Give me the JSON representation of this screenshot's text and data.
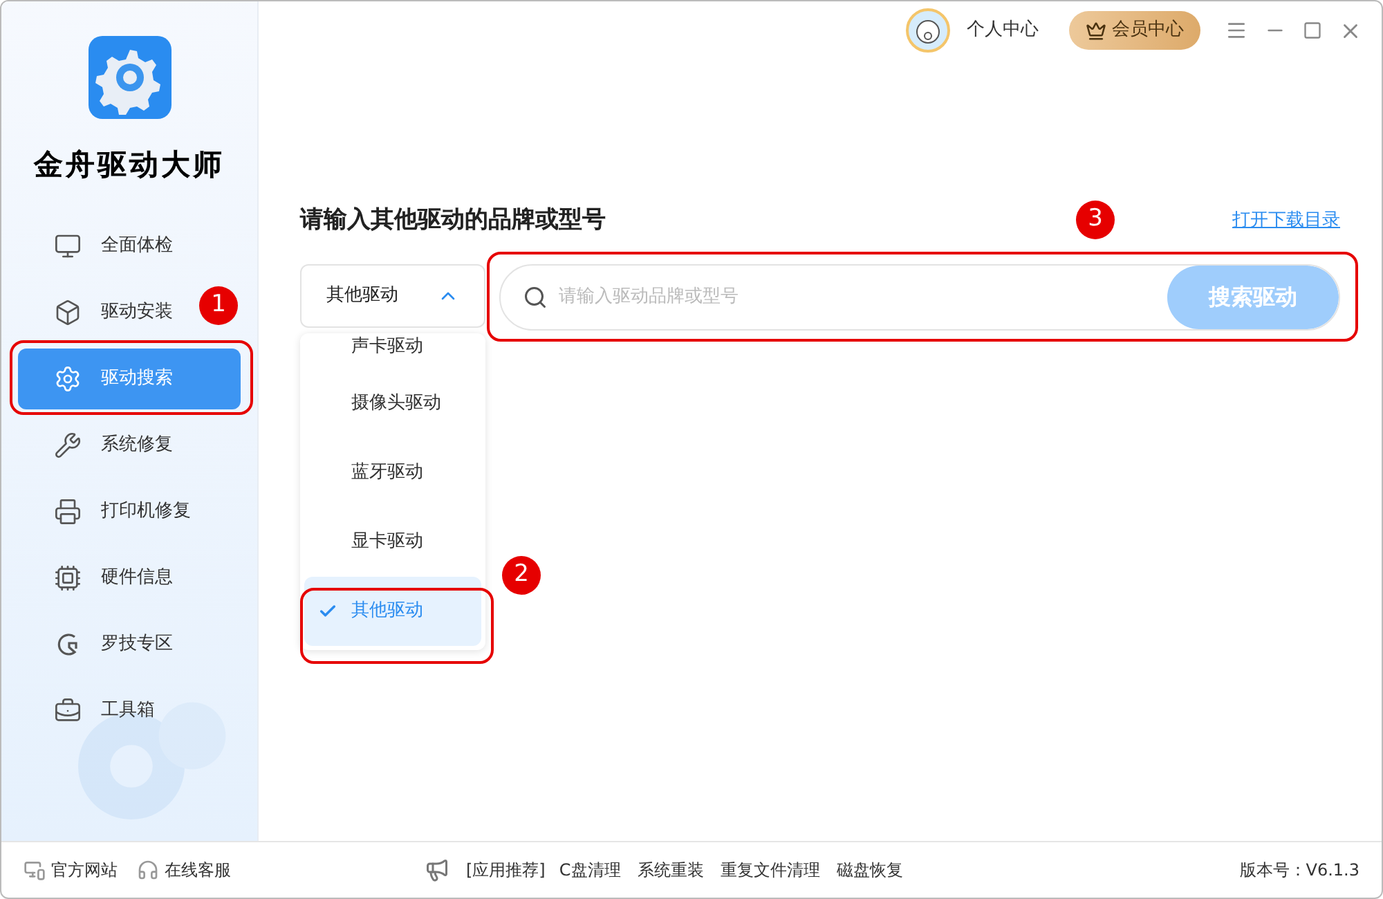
{
  "app": {
    "name": "金舟驱动大师"
  },
  "header": {
    "user": "个人中心",
    "vip": "会员中心"
  },
  "sidebar": {
    "items": [
      {
        "label": "全面体检",
        "selected": false
      },
      {
        "label": "驱动安装",
        "selected": false
      },
      {
        "label": "驱动搜索",
        "selected": true
      },
      {
        "label": "系统修复",
        "selected": false
      },
      {
        "label": "打印机修复",
        "selected": false
      },
      {
        "label": "硬件信息",
        "selected": false
      },
      {
        "label": "罗技专区",
        "selected": false
      },
      {
        "label": "工具箱",
        "selected": false
      }
    ]
  },
  "search": {
    "title": "请输入其他驱动的品牌或型号",
    "open_folder_link": "打开下载目录",
    "category": {
      "value": "其他驱动",
      "expanded": true,
      "options": [
        {
          "label": "声卡驱动",
          "selected": false
        },
        {
          "label": "摄像头驱动",
          "selected": false
        },
        {
          "label": "蓝牙驱动",
          "selected": false
        },
        {
          "label": "显卡驱动",
          "selected": false
        },
        {
          "label": "其他驱动",
          "selected": true
        }
      ]
    },
    "placeholder": "请输入驱动品牌或型号",
    "button": "搜索驱动"
  },
  "annotations": [
    {
      "number": "1"
    },
    {
      "number": "2"
    },
    {
      "number": "3"
    }
  ],
  "footer": {
    "left": [
      "官方网站",
      "在线客服"
    ],
    "promo_label": "[应用推荐]",
    "promo_links": [
      "C盘清理",
      "系统重装",
      "重复文件清理",
      "磁盘恢复"
    ],
    "version": "版本号：V6.1.3"
  }
}
